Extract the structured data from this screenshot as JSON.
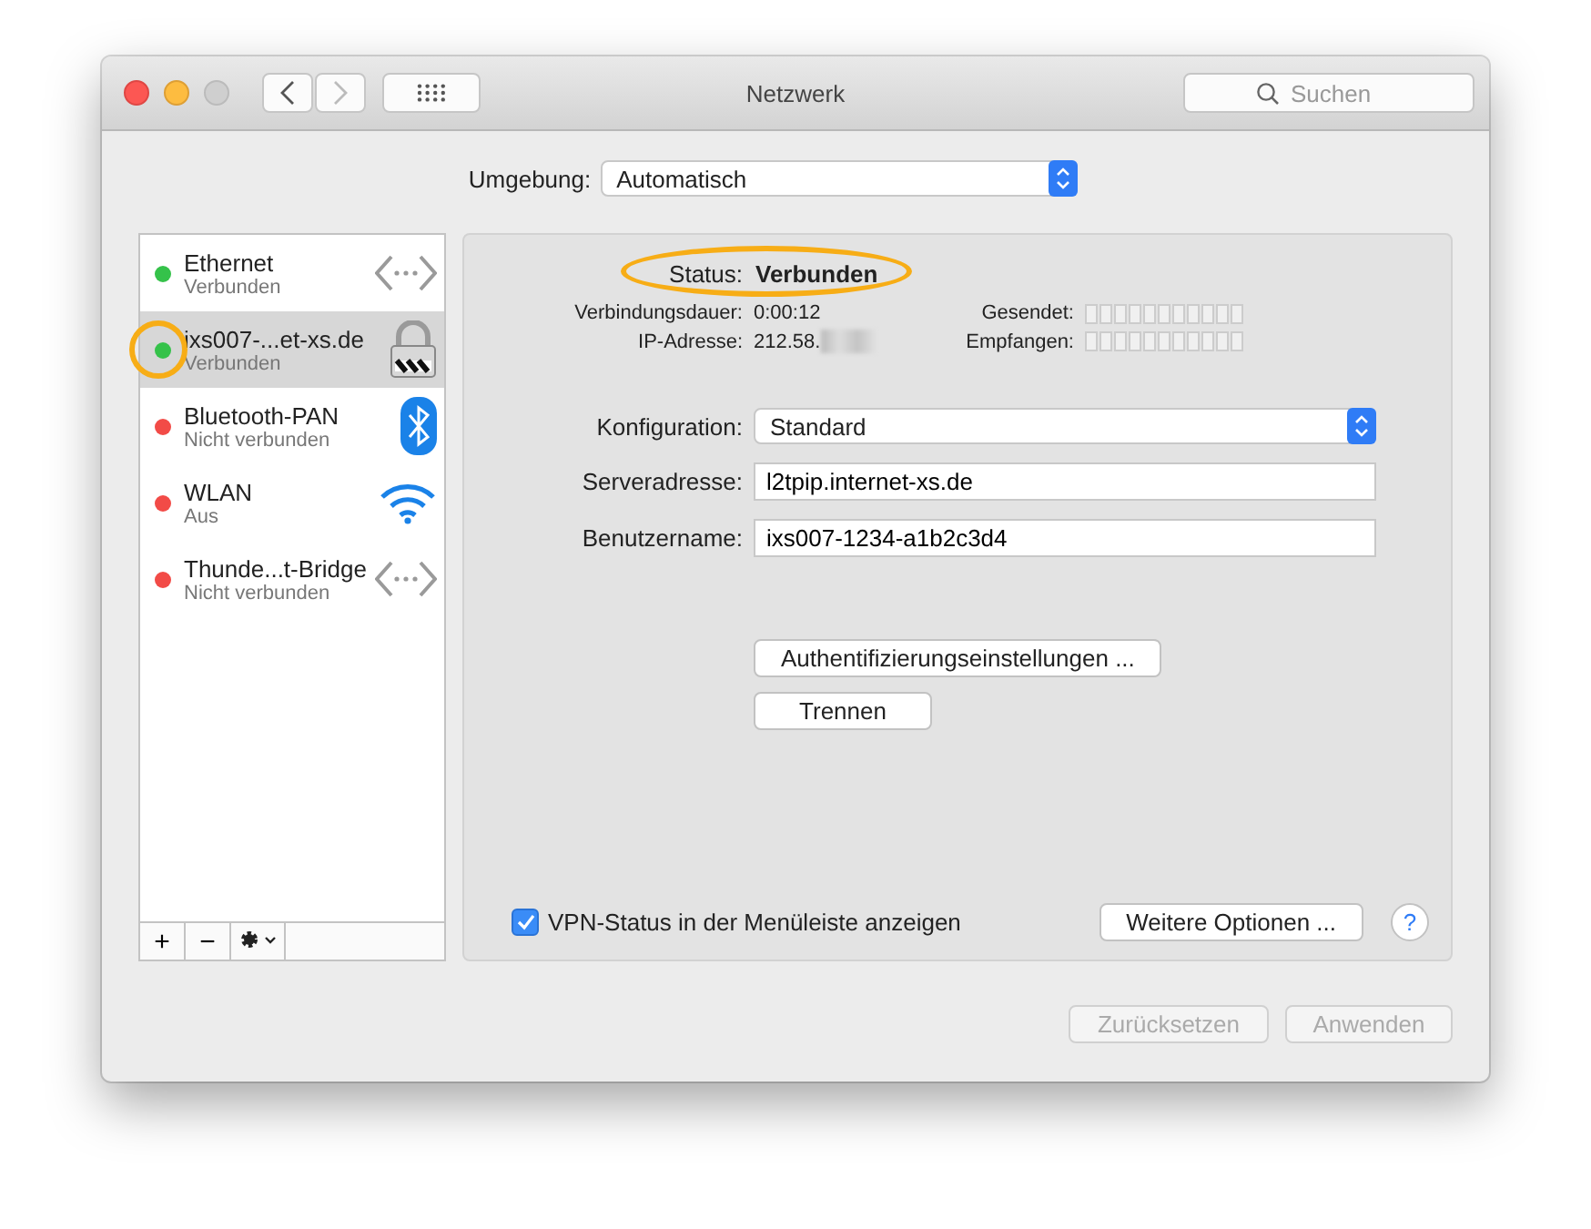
{
  "window": {
    "title": "Netzwerk",
    "search_placeholder": "Suchen"
  },
  "location": {
    "label": "Umgebung:",
    "value": "Automatisch"
  },
  "services": [
    {
      "name": "Ethernet",
      "status": "Verbunden",
      "color": "#35c24a",
      "kind": "ethernet",
      "selected": false,
      "highlighted": false
    },
    {
      "name": "ixs007-...et-xs.de",
      "status": "Verbunden",
      "color": "#35c24a",
      "kind": "vpn",
      "selected": true,
      "highlighted": true
    },
    {
      "name": "Bluetooth-PAN",
      "status": "Nicht verbunden",
      "color": "#f24b47",
      "kind": "bluetooth",
      "selected": false,
      "highlighted": false
    },
    {
      "name": "WLAN",
      "status": "Aus",
      "color": "#f24b47",
      "kind": "wifi",
      "selected": false,
      "highlighted": false
    },
    {
      "name": "Thunde...t-Bridge",
      "status": "Nicht verbunden",
      "color": "#f24b47",
      "kind": "ethernet",
      "selected": false,
      "highlighted": false
    }
  ],
  "list_toolbar": [
    "+",
    "−"
  ],
  "status": {
    "label": "Status:",
    "value": "Verbunden",
    "highlighted": true
  },
  "info": {
    "duration_label": "Verbindungsdauer:",
    "duration": "0:00:12",
    "ip_label": "IP-Adresse:",
    "ip": "212.58.",
    "ip_redacted": true,
    "sent_label": "Gesendet:",
    "received_label": "Empfangen:"
  },
  "form": [
    {
      "kind": "select",
      "label": "Konfiguration:",
      "value": "Standard"
    },
    {
      "kind": "text",
      "label": "Serveradresse:",
      "value": "l2tpip.internet-xs.de"
    },
    {
      "kind": "text",
      "label": "Benutzername:",
      "value": "ixs007-1234-a1b2c3d4"
    }
  ],
  "actions": [
    {
      "label": "Authentifizierungseinstellungen ..."
    },
    {
      "label": "Trennen"
    }
  ],
  "menu_status": {
    "label": "VPN-Status in der Menüleiste anzeigen",
    "checked": true
  },
  "more_button": "Weitere Optionen ...",
  "help": "?",
  "footer": [
    {
      "label": "Zurücksetzen",
      "disabled": true
    },
    {
      "label": "Anwenden",
      "disabled": true
    }
  ]
}
